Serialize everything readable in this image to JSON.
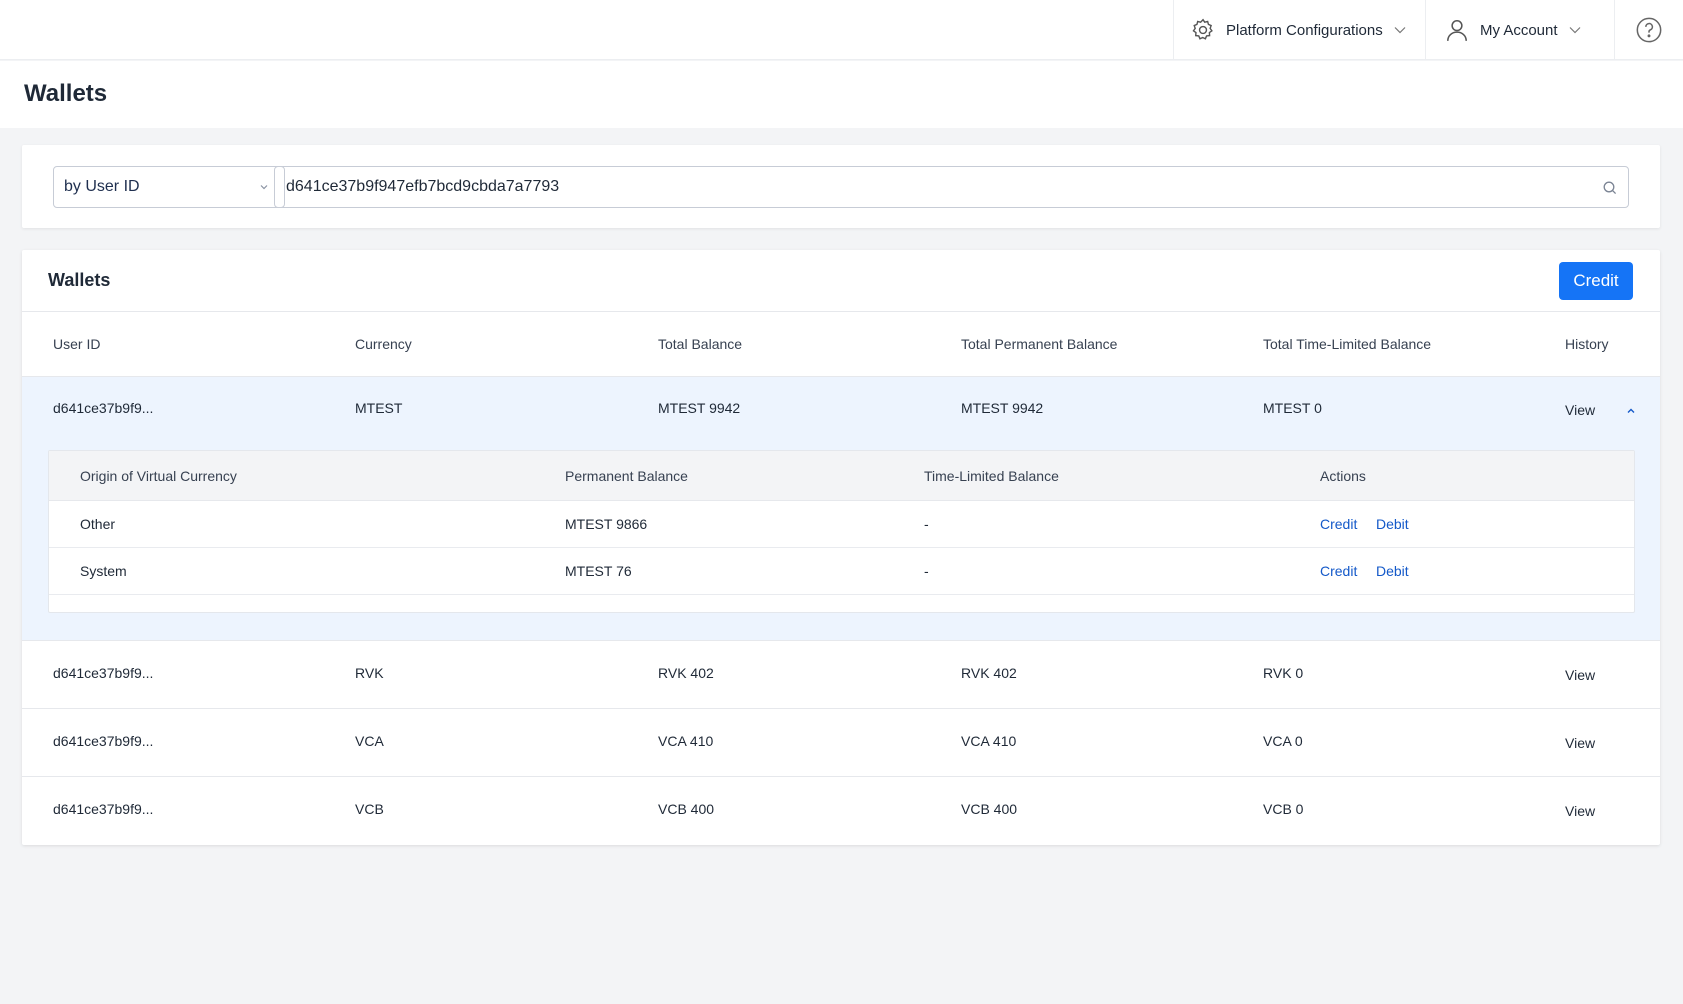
{
  "topbar": {
    "platform_label": "Platform Configurations",
    "account_label": "My Account",
    "icons": {
      "platform": "gear-icon",
      "account": "user-icon",
      "help": "help-circle-icon"
    }
  },
  "page": {
    "title": "Wallets"
  },
  "search": {
    "filter_selected": "by User ID",
    "query": "d641ce37b9f947efb7bcd9cbda7a7793"
  },
  "wallets": {
    "title": "Wallets",
    "credit_button": "Credit",
    "columns": [
      "User ID",
      "Currency",
      "Total Balance",
      "Total Permanent Balance",
      "Total Time-Limited Balance",
      "History"
    ],
    "rows": [
      {
        "user_id": "d641ce37b9f9...",
        "currency": "MTEST",
        "total": "MTEST 9942",
        "permanent": "MTEST 9942",
        "time_limited": "MTEST 0",
        "history": "View"
      },
      {
        "user_id": "d641ce37b9f9...",
        "currency": "RVK",
        "total": "RVK 402",
        "permanent": "RVK 402",
        "time_limited": "RVK 0",
        "history": "View"
      },
      {
        "user_id": "d641ce37b9f9...",
        "currency": "VCA",
        "total": "VCA 410",
        "permanent": "VCA 410",
        "time_limited": "VCA 0",
        "history": "View"
      },
      {
        "user_id": "d641ce37b9f9...",
        "currency": "VCB",
        "total": "VCB 400",
        "permanent": "VCB 400",
        "time_limited": "VCB 0",
        "history": "View"
      }
    ],
    "expanded": {
      "columns": [
        "Origin of Virtual Currency",
        "Permanent Balance",
        "Time-Limited Balance",
        "Actions"
      ],
      "rows": [
        {
          "origin": "Other",
          "permanent": "MTEST 9866",
          "time_limited": "-",
          "credit": "Credit",
          "debit": "Debit"
        },
        {
          "origin": "System",
          "permanent": "MTEST 76",
          "time_limited": "-",
          "credit": "Credit",
          "debit": "Debit"
        }
      ]
    }
  },
  "colors": {
    "primary": "#1574f6",
    "link": "#1459c9",
    "expanded_bg": "#edf4fe",
    "page_bg": "#f3f4f6"
  }
}
